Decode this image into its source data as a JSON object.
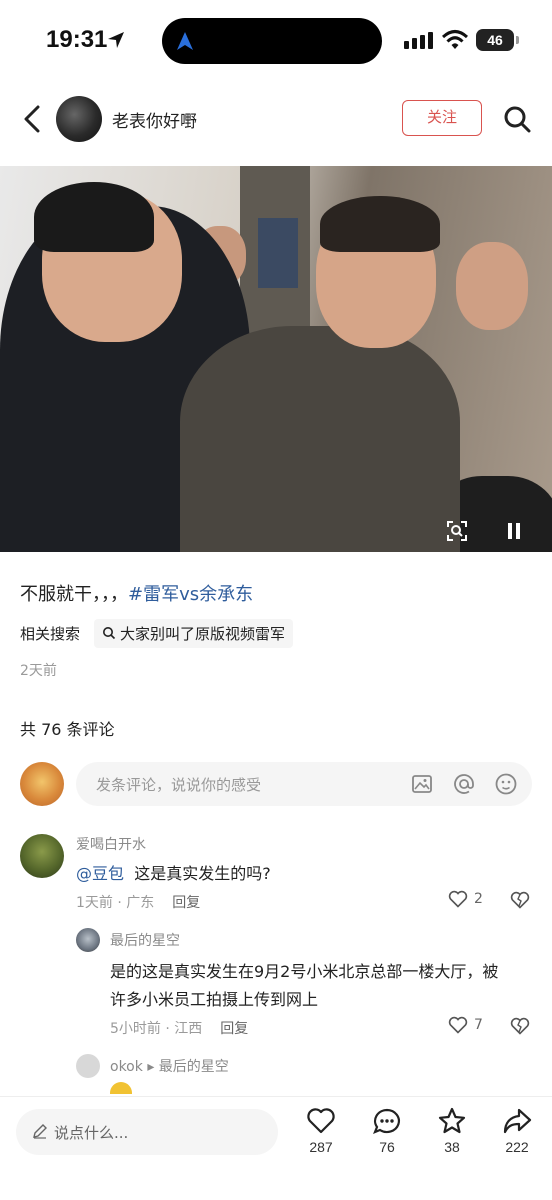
{
  "status_bar": {
    "time": "19:31",
    "battery": "46",
    "icons": [
      "location-arrow-icon",
      "signal-icon",
      "wifi-icon",
      "battery-icon"
    ]
  },
  "header": {
    "author_name": "老表你好嘢",
    "follow_label": "关注",
    "icons": [
      "back-arrow-icon",
      "search-icon"
    ]
  },
  "post": {
    "caption_text": "不服就干，，，",
    "caption_tag": "#雷军vs余承东",
    "related_label": "相关搜索",
    "related_query": "大家别叫了原版视频雷军",
    "time": "2天前"
  },
  "comments": {
    "count_label": "共 76 条评论",
    "input_placeholder": "发条评论，说说你的感受",
    "items": [
      {
        "user": "爱喝白开水",
        "mention": "@豆包",
        "text": "这是真实发生的吗?",
        "meta": "1天前 · 广东",
        "reply_label": "回复",
        "likes": "2"
      }
    ],
    "replies": [
      {
        "user": "最后的星空",
        "text": "是的这是真实发生在9月2号小米北京总部一楼大厅，被许多小米员工拍摄上传到网上",
        "meta": "5小时前 · 江西",
        "reply_label": "回复",
        "likes": "7"
      },
      {
        "user": "okok",
        "reply_to": "最后的星空"
      }
    ]
  },
  "bottom_bar": {
    "say_placeholder": "说点什么...",
    "likes": "287",
    "comments": "76",
    "favorites": "38",
    "shares": "222"
  },
  "colors": {
    "accent_red": "#d9534f",
    "link_blue": "#2f5d9c",
    "muted_gray": "#9a9a9a"
  }
}
